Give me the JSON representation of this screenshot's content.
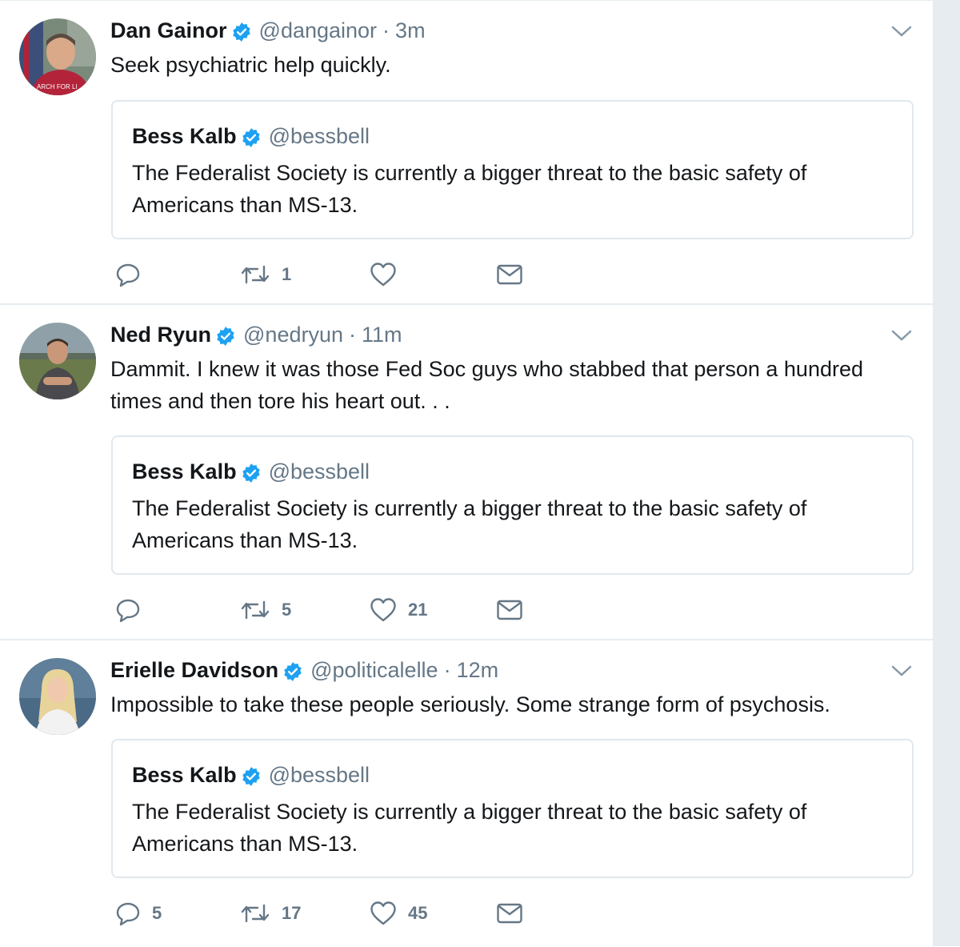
{
  "colors": {
    "verified": "#1da1f2",
    "text": "#14171a",
    "muted": "#657786",
    "border": "#e6ecf0"
  },
  "tweets": [
    {
      "name": "Dan Gainor",
      "handle": "@dangainor",
      "separator": "·",
      "time": "3m",
      "text": "Seek psychiatric help quickly.",
      "avatar_text": "ARCH FOR LI",
      "quote": {
        "name": "Bess Kalb",
        "handle": "@bessbell",
        "text": "The Federalist Society is currently a bigger threat to the basic safety of Americans than MS-13."
      },
      "actions": {
        "replies": "",
        "retweets": "1",
        "likes": ""
      }
    },
    {
      "name": "Ned Ryun",
      "handle": "@nedryun",
      "separator": "·",
      "time": "11m",
      "text": "Dammit. I knew it was those Fed Soc guys who stabbed that person a hundred times and then tore his heart out. . .",
      "quote": {
        "name": "Bess Kalb",
        "handle": "@bessbell",
        "text": "The Federalist Society is currently a bigger threat to the basic safety of Americans than MS-13."
      },
      "actions": {
        "replies": "",
        "retweets": "5",
        "likes": "21"
      }
    },
    {
      "name": "Erielle Davidson",
      "handle": "@politicalelle",
      "separator": "·",
      "time": "12m",
      "text": "Impossible to take these people seriously. Some strange form of psychosis.",
      "quote": {
        "name": "Bess Kalb",
        "handle": "@bessbell",
        "text": "The Federalist Society is currently a bigger threat to the basic safety of Americans than MS-13."
      },
      "actions": {
        "replies": "5",
        "retweets": "17",
        "likes": "45"
      }
    }
  ]
}
